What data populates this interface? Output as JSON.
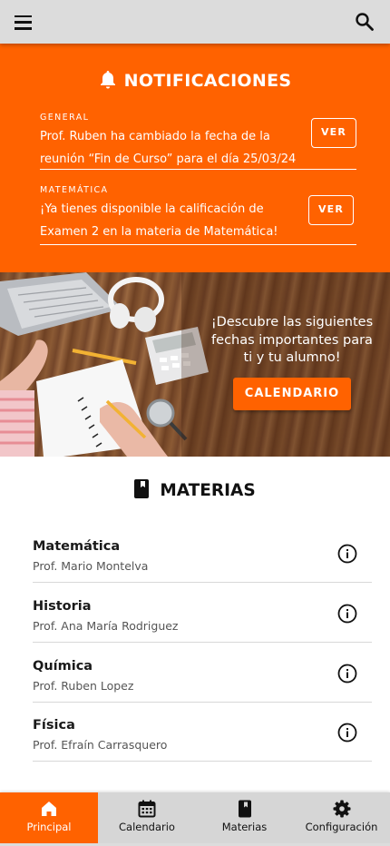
{
  "topbar": {
    "menu_icon": "hamburger-menu-icon",
    "search_icon": "search-icon",
    "background": "#dcdcdc"
  },
  "notifications": {
    "title": "NOTIFICACIONES",
    "icon": "bell-icon",
    "accent": "#ff6200",
    "items": [
      {
        "category": "GENERAL",
        "message": "Prof. Ruben ha cambiado la fecha de la reunión “Fin de Curso” para el día 25/03/24",
        "action": "VER"
      },
      {
        "category": "MATEMÁTICA",
        "message": "¡Ya tienes disponible la calificación de Examen 2 en la materia de Matemática!",
        "action": "VER"
      }
    ]
  },
  "banner": {
    "text": "¡Descubre las siguientes fechas importantes para ti y tu alumno!",
    "button": "CALENDARIO"
  },
  "materias": {
    "title": "MATERIAS",
    "icon": "book-icon",
    "items": [
      {
        "name": "Matemática",
        "prof": "Prof. Mario Montelva"
      },
      {
        "name": "Historia",
        "prof": "Prof. Ana María Rodriguez"
      },
      {
        "name": "Química",
        "prof": "Prof. Ruben Lopez"
      },
      {
        "name": "Física",
        "prof": "Prof. Efraín Carrasquero"
      }
    ]
  },
  "bottom_nav": {
    "items": [
      {
        "label": "Principal",
        "icon": "home-icon",
        "active": true
      },
      {
        "label": "Calendario",
        "icon": "calendar-icon",
        "active": false
      },
      {
        "label": "Materias",
        "icon": "book-icon",
        "active": false
      },
      {
        "label": "Configuración",
        "icon": "gear-icon",
        "active": false
      }
    ]
  }
}
